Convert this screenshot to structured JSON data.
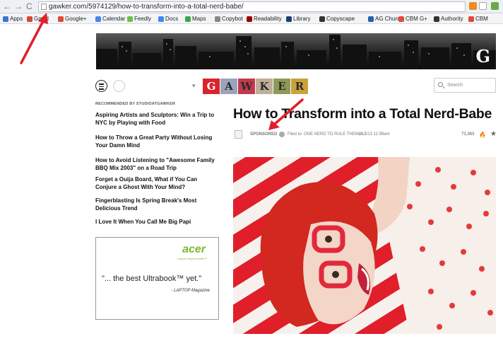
{
  "browser": {
    "url": "gawker.com/5974129/how-to-transform-into-a-total-nerd-babe/",
    "back_glyph": "←",
    "forward_glyph": "→",
    "reload_glyph": "C",
    "bookmarks": [
      {
        "label": "Apps",
        "color": "#3b73d4"
      },
      {
        "label": "Gmail",
        "color": "#d14836"
      },
      {
        "label": "Google+",
        "color": "#dd4b39"
      },
      {
        "label": "Calendar",
        "color": "#4a86e8"
      },
      {
        "label": "Feedly",
        "color": "#6cc04a"
      },
      {
        "label": "Docs",
        "color": "#4285f4"
      },
      {
        "label": "Maps",
        "color": "#34a853"
      },
      {
        "label": "Copybot",
        "color": "#888888"
      },
      {
        "label": "Readability",
        "color": "#990000"
      },
      {
        "label": "Library",
        "color": "#1a3d7c"
      },
      {
        "label": "Copyscape",
        "color": "#333333"
      },
      {
        "label": "AG Church",
        "color": "#2a5db0"
      },
      {
        "label": "CBM G+",
        "color": "#dd4b39"
      },
      {
        "label": "Authority",
        "color": "#333333"
      },
      {
        "label": "CBM",
        "color": "#dd4b39"
      }
    ]
  },
  "site": {
    "header_letter": "G",
    "logo_letters": [
      "G",
      "A",
      "W",
      "K",
      "E",
      "R"
    ],
    "logo_colors": [
      "#d8242c",
      "#9aa3bb",
      "#c23a4e",
      "#bfae9a",
      "#8e9a55",
      "#c9a23a"
    ],
    "search_placeholder": "Search",
    "dropdown_glyph": "▾"
  },
  "sidebar": {
    "heading": "RECOMMENDED BY STUDIOATGAWKER",
    "items": [
      "Aspiring Artists and Sculptors: Win a Trip to NYC by Playing with Food",
      "How to Throw a Great Party Without Losing Your Damn Mind",
      "How to Avoid Listening to \"Awesome Family BBQ Mix 2003\" on a Road Trip",
      "Forget a Ouija Board, What if You Can Conjure a Ghost With Your Mind?",
      "Fingerblasting Is Spring Break's Most Delicious Trend",
      "I Love It When You Call Me Big Papi"
    ]
  },
  "ad": {
    "brand": "acer",
    "tagline": "explore beyond limits™",
    "quote": "\"... the best Ultrabook™ yet.\"",
    "source": "- LAPTOP Magazine"
  },
  "article": {
    "title": "How to Transform into a Total Nerd-Babe",
    "sponsored": "SPONSORED",
    "filed": "Filed to: ONE NERD TO RULE THEM ALL",
    "time": "1/17/13 11:59am",
    "views": "73,363",
    "flame_glyph": "🔥",
    "star_glyph": "★"
  },
  "colors": {
    "arrow": "#e0202a",
    "photo_red": "#e01f2b"
  }
}
